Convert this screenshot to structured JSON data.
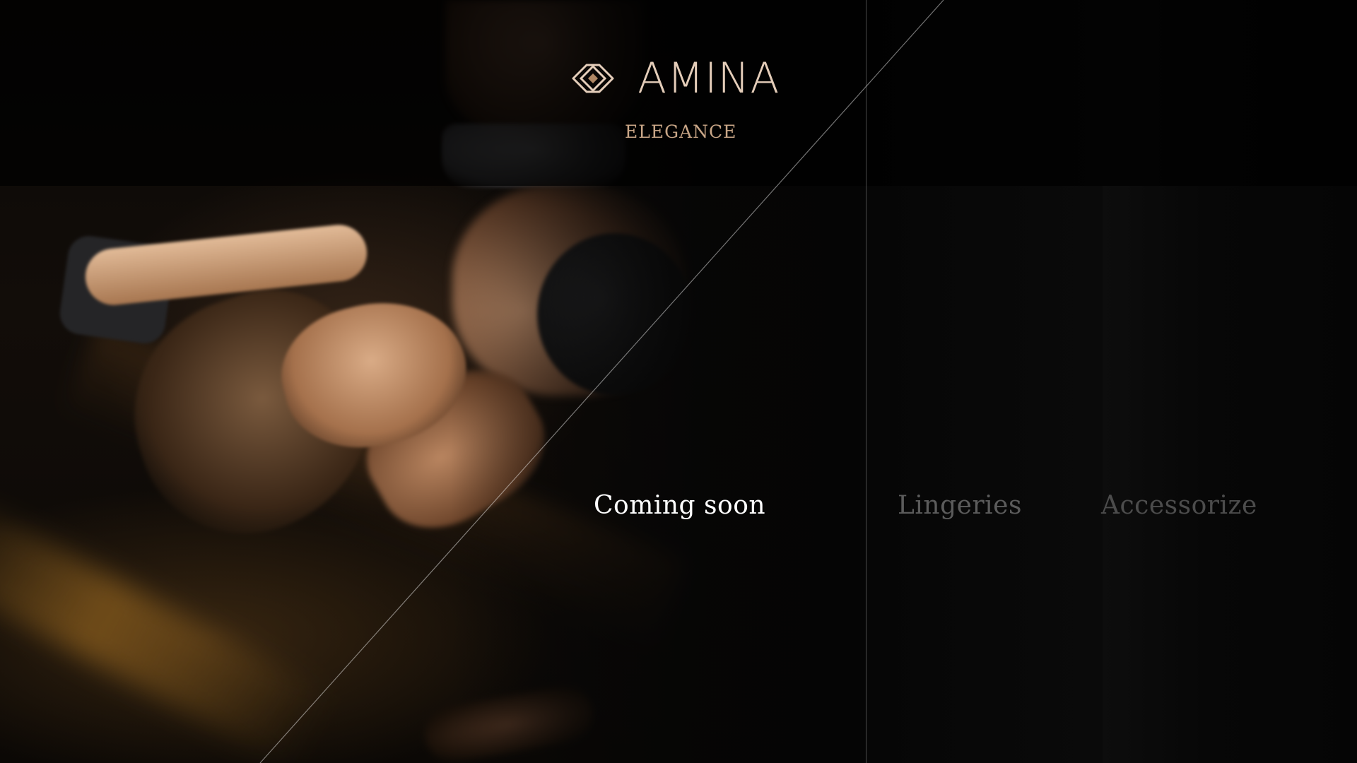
{
  "brand": {
    "name": "AMINA",
    "tagline": "ELEGANCE",
    "logo_icon": "diamond-logo-icon",
    "colors": {
      "logo": "#e4cdb9",
      "tagline": "#c9a687",
      "background": "#050505"
    }
  },
  "hero": {
    "image": "woman-lying-in-shadow-photo"
  },
  "nav": {
    "items": [
      {
        "label": "Coming soon",
        "active": true,
        "color": "#ffffff"
      },
      {
        "label": "Lingeries",
        "active": false,
        "color": "#5b5b5b"
      },
      {
        "label": "Accessorize",
        "active": false,
        "color": "#4c4c4c"
      }
    ]
  }
}
